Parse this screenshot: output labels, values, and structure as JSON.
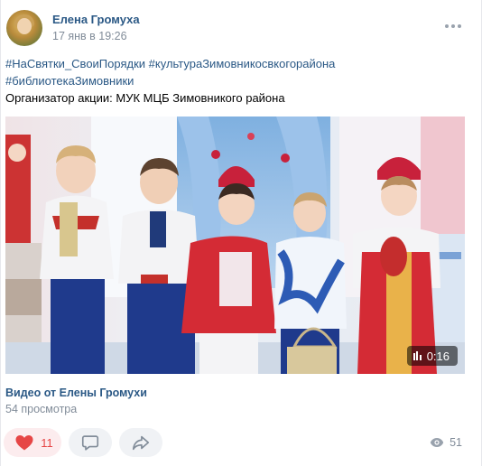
{
  "post": {
    "author": "Елена Громуха",
    "date": "17 янв в 19:26",
    "text": {
      "hashtags_line1": [
        "#НаСвятки_СвоиПорядки",
        "#культураЗимовникосвкогорайона"
      ],
      "hashtags_line2": [
        "#библиотекаЗимовники"
      ],
      "body": "Организатор акции: МУК МЦБ Зимовникого района"
    },
    "video": {
      "duration": "0:16",
      "title": "Видео от Елены Громухи",
      "views": "54 просмотра"
    },
    "actions": {
      "likes": "11",
      "views": "51"
    }
  },
  "icons": {
    "more": "more-dots-icon",
    "like": "heart-icon",
    "comment": "comment-icon",
    "share": "share-icon",
    "views": "eye-icon",
    "duration": "video-bars-icon"
  },
  "colors": {
    "link": "#2a5885",
    "secondary": "#818c99",
    "like_red": "#e64646",
    "like_bg": "#fcecee",
    "pill_bg": "#f0f2f5"
  }
}
